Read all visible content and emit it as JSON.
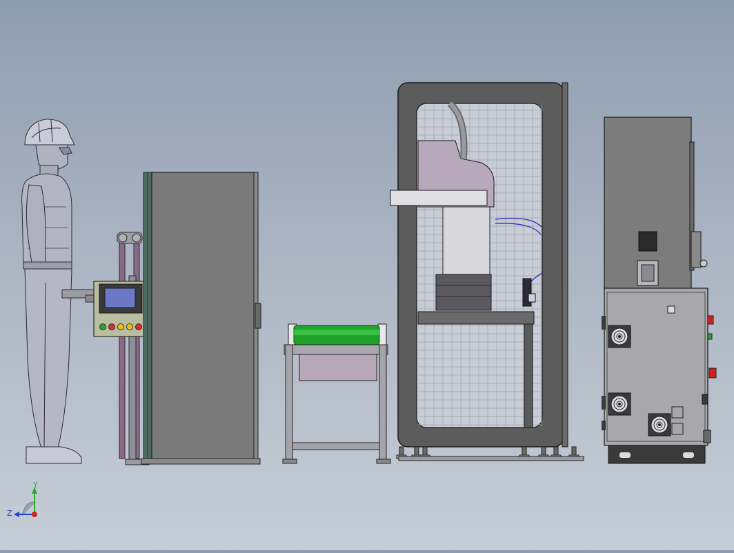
{
  "triad": {
    "y_label": "Y",
    "z_label": "Z",
    "colors": {
      "y": "#2eaa2e",
      "z": "#2040d0",
      "x": "#d02020"
    }
  },
  "palette": {
    "background_top": "#8e9db0",
    "background_bottom": "#c6cdd6",
    "cabinet": "#7a7a7a",
    "frame_dark": "#3a3a3a",
    "roller_green": "#1fa32a",
    "pipe_purple": "#8a6a88",
    "hmi_screen": "#6b78c8"
  },
  "hmi_buttons": [
    {
      "color": "#2ea02e"
    },
    {
      "color": "#d03030"
    },
    {
      "color": "#e0c020"
    },
    {
      "color": "#e0c020"
    },
    {
      "color": "#d03030"
    }
  ]
}
